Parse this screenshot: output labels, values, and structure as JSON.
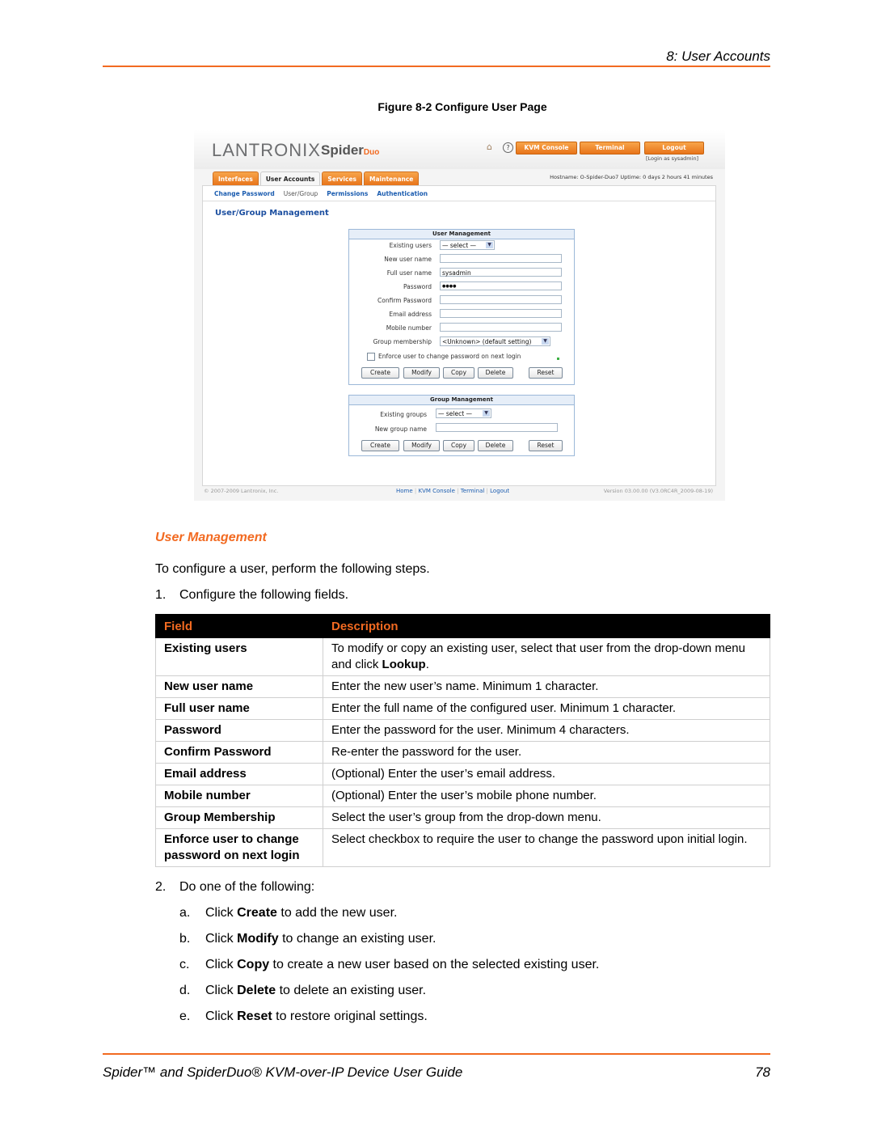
{
  "header": {
    "chapter": "8: User Accounts"
  },
  "figure": {
    "caption": "Figure 8-2  Configure User Page"
  },
  "screenshot": {
    "logo_brand": "LANTRONIX",
    "logo_product": "Spider",
    "logo_product_suffix": "Duo",
    "icons": {
      "home": "home-icon",
      "help": "help-icon"
    },
    "top_buttons": [
      "KVM Console",
      "Terminal",
      "Logout"
    ],
    "login_as": "[Login as sysadmin]",
    "tabs": [
      {
        "label": "Interfaces",
        "active": false
      },
      {
        "label": "User Accounts",
        "active": true
      },
      {
        "label": "Services",
        "active": false
      },
      {
        "label": "Maintenance",
        "active": false
      }
    ],
    "hostinfo": "Hostname: O-Spider-Duo7    Uptime: 0 days 2 hours 41 minutes",
    "subnav": [
      {
        "label": "Change Password",
        "current": false
      },
      {
        "label": "User/Group",
        "current": true
      },
      {
        "label": "Permissions",
        "current": false
      },
      {
        "label": "Authentication",
        "current": false
      }
    ],
    "page_heading": "User/Group Management",
    "user_panel": {
      "title": "User Management",
      "existing_users_label": "Existing users",
      "existing_users_value": "— select —",
      "new_user_label": "New user name",
      "new_user_value": "",
      "full_name_label": "Full user name",
      "full_name_value": "sysadmin",
      "password_label": "Password",
      "password_value": "●●●●",
      "confirm_label": "Confirm Password",
      "confirm_value": "",
      "email_label": "Email address",
      "email_value": "",
      "mobile_label": "Mobile number",
      "mobile_value": "",
      "group_label": "Group membership",
      "group_value": "<Unknown> (default setting)",
      "enforce_label": "Enforce user to change password on next login",
      "enforce_checked": false,
      "buttons": [
        "Create",
        "Modify",
        "Copy",
        "Delete",
        "Reset"
      ]
    },
    "group_panel": {
      "title": "Group Management",
      "existing_groups_label": "Existing groups",
      "existing_groups_value": "— select —",
      "new_group_label": "New group name",
      "new_group_value": "",
      "buttons": [
        "Create",
        "Modify",
        "Copy",
        "Delete",
        "Reset"
      ]
    },
    "footer": {
      "copyright": "© 2007-2009 Lantronix, Inc.",
      "links": [
        "Home",
        "KVM Console",
        "Terminal",
        "Logout"
      ],
      "version": "Version 03.00.00 (V3.0RC4R_2009-08-19)"
    }
  },
  "section": {
    "heading": "User Management",
    "intro": "To configure a user, perform the following steps.",
    "step1_num": "1.",
    "step1": "Configure the following fields."
  },
  "table": {
    "headers": [
      "Field",
      "Description"
    ],
    "rows": [
      {
        "field": "Existing users",
        "desc_pre": "To modify or copy an existing user, select that user from the drop-down menu and click ",
        "desc_bold": "Lookup",
        "desc_post": "."
      },
      {
        "field": "New user name",
        "desc_pre": "Enter the new user’s name. Minimum 1 character.",
        "desc_bold": "",
        "desc_post": ""
      },
      {
        "field": "Full user name",
        "desc_pre": "Enter the full name of the configured user. Minimum 1 character.",
        "desc_bold": "",
        "desc_post": ""
      },
      {
        "field": "Password",
        "desc_pre": "Enter the password for the user. Minimum 4 characters.",
        "desc_bold": "",
        "desc_post": ""
      },
      {
        "field": "Confirm Password",
        "desc_pre": "Re-enter the password for the user.",
        "desc_bold": "",
        "desc_post": ""
      },
      {
        "field": "Email address",
        "desc_pre": "(Optional) Enter the user’s email address.",
        "desc_bold": "",
        "desc_post": ""
      },
      {
        "field": "Mobile number",
        "desc_pre": "(Optional) Enter the user’s mobile phone number.",
        "desc_bold": "",
        "desc_post": ""
      },
      {
        "field": "Group Membership",
        "desc_pre": "Select the user’s group from the drop-down menu.",
        "desc_bold": "",
        "desc_post": ""
      },
      {
        "field": "Enforce user to change password on next login",
        "desc_pre": "Select checkbox to require the user to change the password upon initial login.",
        "desc_bold": "",
        "desc_post": ""
      }
    ]
  },
  "step2": {
    "num": "2.",
    "text": "Do one of the following:",
    "items": [
      {
        "letter": "a.",
        "pre": "Click ",
        "bold": "Create",
        "post": " to add the new user."
      },
      {
        "letter": "b.",
        "pre": "Click ",
        "bold": "Modify",
        "post": " to change an existing user."
      },
      {
        "letter": "c.",
        "pre": "Click ",
        "bold": "Copy",
        "post": " to create a new user based on the selected existing user."
      },
      {
        "letter": "d.",
        "pre": "Click ",
        "bold": "Delete",
        "post": " to delete an existing user."
      },
      {
        "letter": "e.",
        "pre": "Click ",
        "bold": "Reset",
        "post": " to restore original settings."
      }
    ]
  },
  "footer": {
    "title": "Spider™ and SpiderDuo® KVM-over-IP Device User Guide",
    "page": "78"
  },
  "colors": {
    "accent": "#f26a21",
    "link": "#1c5db0",
    "table_header_bg": "#000000"
  }
}
